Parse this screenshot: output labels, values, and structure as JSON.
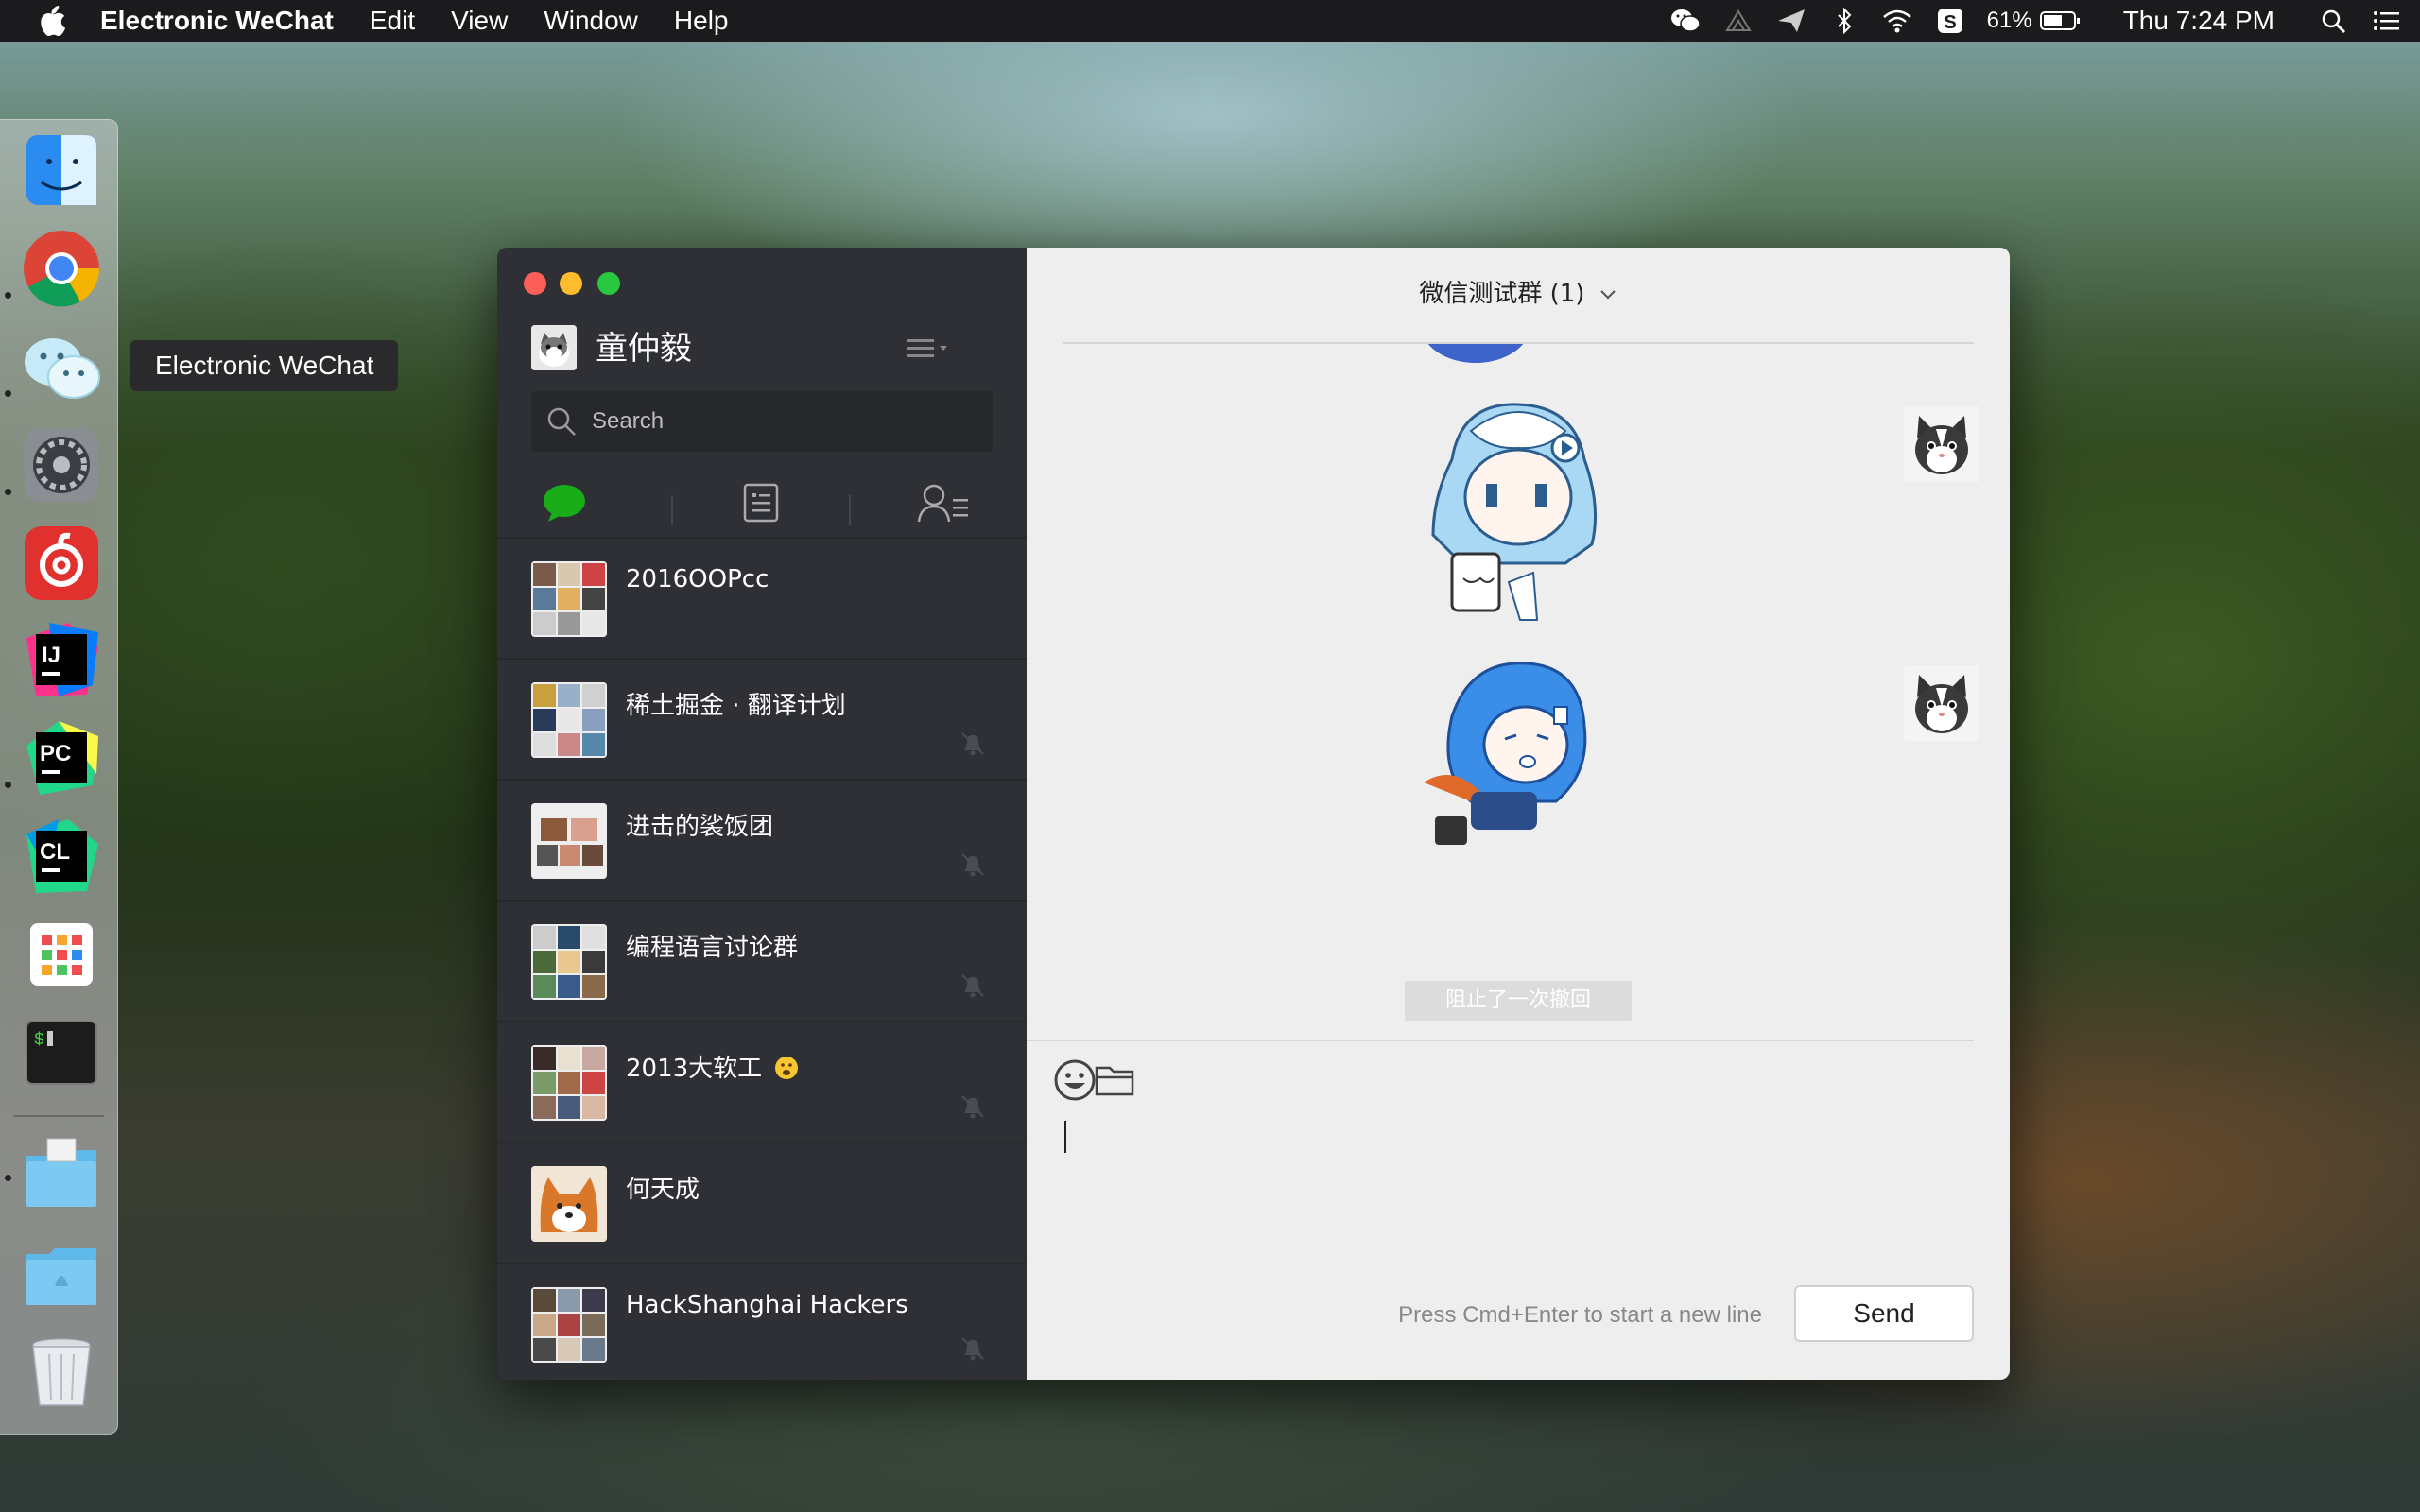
{
  "menubar": {
    "app_name": "Electronic WeChat",
    "menus": [
      "Edit",
      "View",
      "Window",
      "Help"
    ],
    "battery_percent": "61%",
    "clock": "Thu 7:24 PM",
    "status_icons": [
      "wechat-icon",
      "wechat-helper-icon",
      "send-icon",
      "bluetooth-icon",
      "wifi-icon",
      "sogou-input-icon",
      "battery-icon",
      "spotlight-search-icon",
      "notification-center-icon"
    ]
  },
  "dock": {
    "tooltip": "Electronic WeChat",
    "apps": [
      "finder",
      "chrome",
      "wechat",
      "system-preferences",
      "netease-music",
      "intellij-idea",
      "pycharm",
      "clion",
      "launchpad",
      "terminal",
      "downloads-folder",
      "home-folder",
      "trash"
    ]
  },
  "sidebar": {
    "user_name": "童仲毅",
    "search_placeholder": "Search",
    "tabs": [
      "chats",
      "public-accounts",
      "contacts"
    ],
    "conversations": [
      {
        "name": "2016OOPcc",
        "muted": false
      },
      {
        "name": "稀土掘金 · 翻译计划",
        "muted": true
      },
      {
        "name": "进击的裟饭团",
        "muted": true
      },
      {
        "name": "编程语言讨论群",
        "muted": true
      },
      {
        "name": "2013大软工",
        "muted": true,
        "emoji": "face-emoji"
      },
      {
        "name": "何天成",
        "muted": false
      },
      {
        "name": "HackShanghai Hackers",
        "muted": true
      }
    ]
  },
  "chat": {
    "title": "微信测试群 (1)",
    "notice": "阻止了一次撤回",
    "input_hint": "Press Cmd+Enter to start a new line",
    "send_label": "Send"
  },
  "colors": {
    "sidebar_bg": "#2e3036",
    "chat_bg": "#eeeeee",
    "accent_green": "#1aad19"
  }
}
